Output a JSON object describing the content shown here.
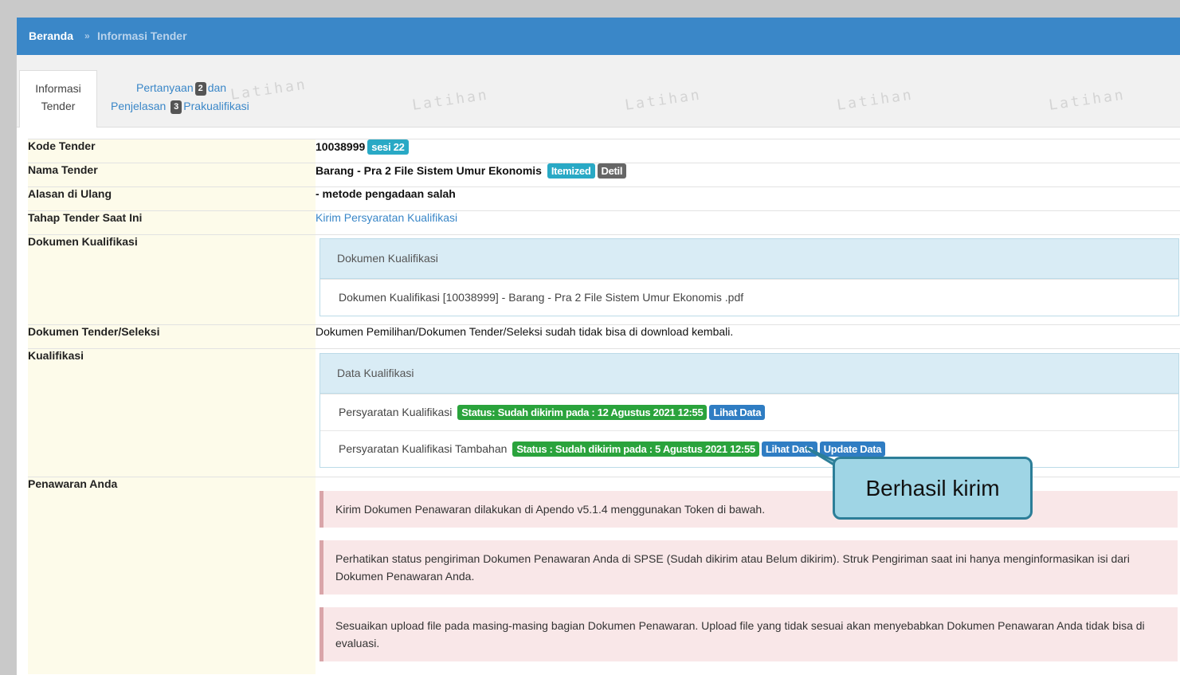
{
  "breadcrumb": {
    "home": "Beranda",
    "separator": "»",
    "current": "Informasi Tender"
  },
  "tabs": {
    "active": {
      "line1": "Informasi",
      "line2": "Tender"
    },
    "other": {
      "w1": "Pertanyaan",
      "n1": "2",
      "w2": "dan",
      "w3": "Penjelasan",
      "n2": "3",
      "w4": "Prakualifikasi"
    }
  },
  "watermark": "Latihan",
  "rows": {
    "kode": {
      "label": "Kode Tender",
      "value": "10038999",
      "badge": "sesi 22"
    },
    "nama": {
      "label": "Nama Tender",
      "value": "Barang - Pra 2 File Sistem Umur Ekonomis",
      "badge1": "Itemized",
      "badge2": "Detil"
    },
    "alasan": {
      "label": "Alasan di Ulang",
      "value": "- metode pengadaan salah"
    },
    "tahap": {
      "label": "Tahap Tender Saat Ini",
      "value": "Kirim Persyaratan Kualifikasi"
    },
    "dokkual": {
      "label": "Dokumen Kualifikasi",
      "panel_title": "Dokumen Kualifikasi",
      "file": "Dokumen Kualifikasi [10038999] - Barang - Pra 2 File Sistem Umur Ekonomis .pdf"
    },
    "doktender": {
      "label": "Dokumen Tender/Seleksi",
      "value": "Dokumen Pemilihan/Dokumen Tender/Seleksi sudah tidak bisa di download kembali."
    },
    "kualifikasi": {
      "label": "Kualifikasi",
      "panel_title": "Data Kualifikasi",
      "item1": {
        "name": "Persyaratan Kualifikasi",
        "status": "Status: Sudah dikirim pada : 12 Agustus 2021 12:55",
        "view": "Lihat Data"
      },
      "item2": {
        "name": "Persyaratan Kualifikasi Tambahan",
        "status": "Status : Sudah dikirim pada : 5 Agustus 2021 12:55",
        "view": "Lihat Data",
        "update": "Update Data"
      }
    },
    "penawaran": {
      "label": "Penawaran Anda",
      "alert1": "Kirim Dokumen Penawaran dilakukan di Apendo v5.1.4 menggunakan Token di bawah.",
      "alert2": "Perhatikan status pengiriman Dokumen Penawaran Anda di SPSE (Sudah dikirim atau Belum dikirim). Struk Pengiriman saat ini hanya menginformasikan isi dari Dokumen Penawaran Anda.",
      "alert3": "Sesuaikan upload file pada masing-masing bagian Dokumen Penawaran. Upload file yang tidak sesuai akan menyebabkan Dokumen Penawaran Anda tidak bisa di evaluasi."
    }
  },
  "callout": "Berhasil kirim",
  "colors": {
    "topbar": "#3a87c8",
    "label_bg": "#fdfbea",
    "badge_teal": "#29a9c5",
    "badge_green": "#2aa33c",
    "badge_blue": "#2f7dc3",
    "callout_bg": "#9fd5e5"
  }
}
